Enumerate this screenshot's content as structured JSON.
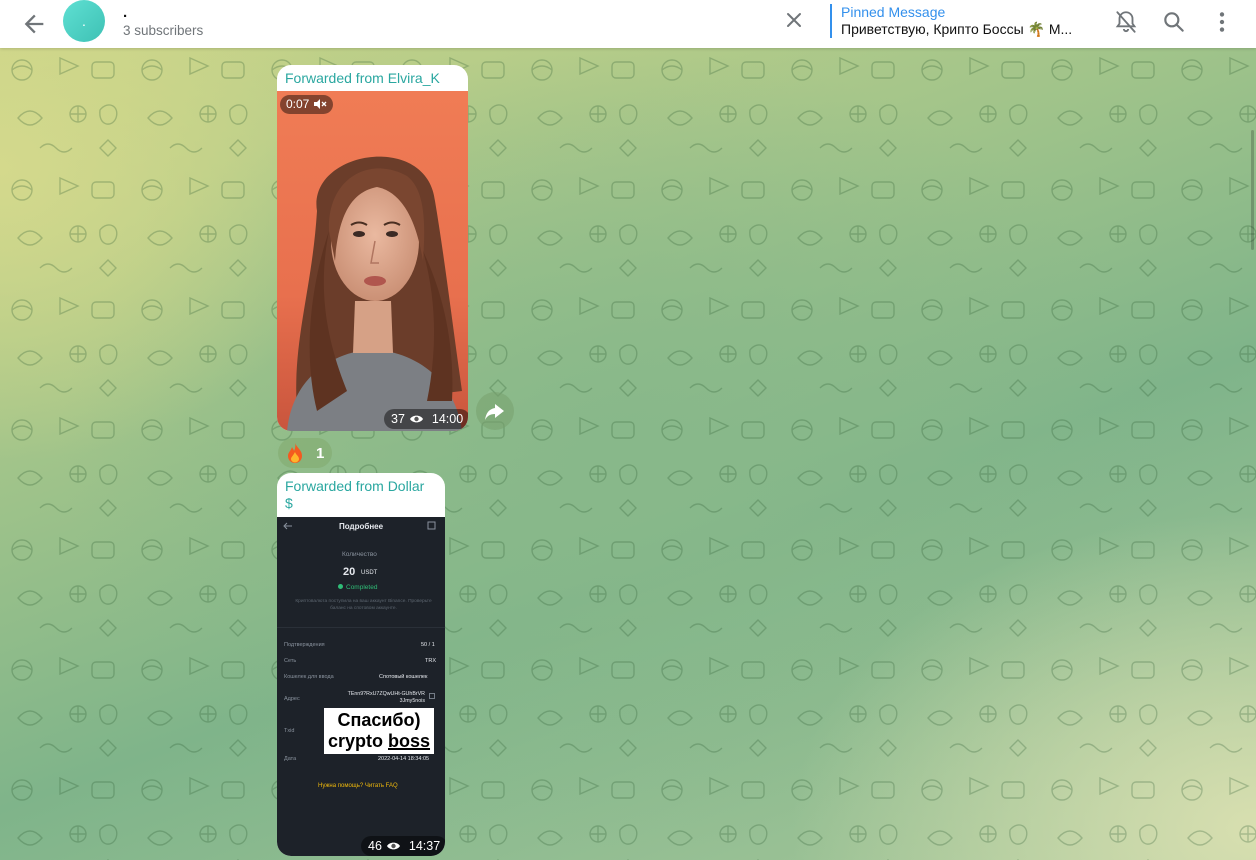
{
  "header": {
    "title": ".",
    "subscribers": "3 subscribers",
    "avatar_letter": ".",
    "pinned_label": "Pinned Message",
    "pinned_text": "Приветствую, Крипто Боссы 🌴 М..."
  },
  "messages": [
    {
      "forwarded_from": "Forwarded from Elvira_K",
      "video_duration": "0:07",
      "views": "37",
      "time": "14:00",
      "reaction_emoji": "fire",
      "reaction_count": "1"
    },
    {
      "forwarded_from": "Forwarded from Dollar $",
      "views": "46",
      "time": "14:37",
      "screenshot": {
        "title": "Подробнее",
        "amount_label": "Количество",
        "amount": "20",
        "currency": "USDT",
        "status": "Completed",
        "note": "Криптовалюта поступила на ваш аккаунт Binance. Проверьте баланс на спотовом аккаунте.",
        "rows": [
          {
            "label": "Подтверждения",
            "value": "50 / 1"
          },
          {
            "label": "Сеть",
            "value": "TRX"
          },
          {
            "label": "Кошелек для ввода",
            "value": "Спотовый кошелек"
          },
          {
            "label": "Адрес",
            "value": "TEnn9?RxU7ZQwUHt-GUhBrVR 3Jmy5nois"
          },
          {
            "label": "Txid",
            "value": ""
          },
          {
            "label": "Дата",
            "value": "2022-04-14 18:34:05"
          }
        ],
        "help_link": "Нужна помощь? Читать FAQ",
        "stamp_line1": "Спасибо)",
        "stamp_line2a": "crypto ",
        "stamp_line2b": "boss"
      }
    }
  ]
}
